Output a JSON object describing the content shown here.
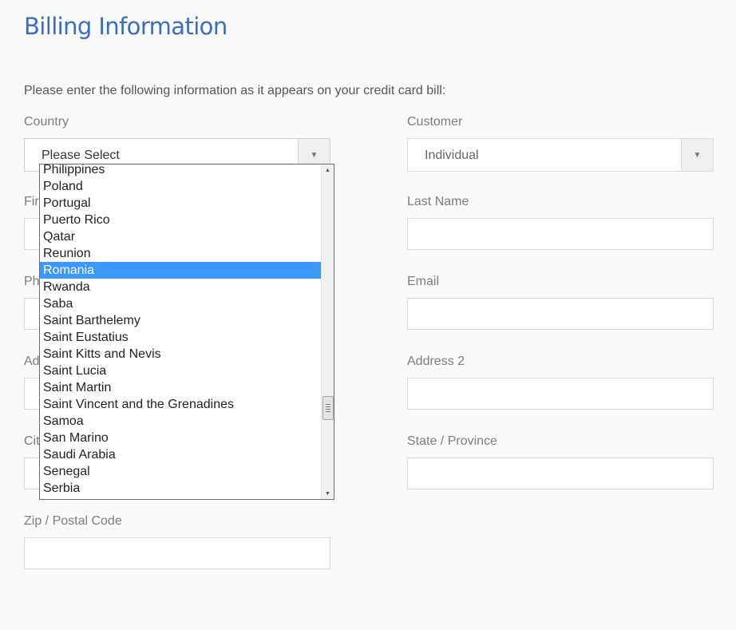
{
  "page": {
    "title": "Billing Information",
    "intro": "Please enter the following information as it appears on your credit card bill:"
  },
  "fields": {
    "country_label": "Country",
    "country_value": "Please Select",
    "customer_label": "Customer",
    "customer_value": "Individual",
    "first_name_label_visible": "Fir",
    "last_name_label": "Last Name",
    "phone_label_visible": "Ph",
    "email_label": "Email",
    "address_label_visible": "Ad",
    "address2_label": "Address 2",
    "city_label_visible": "Cit",
    "state_label": "State / Province",
    "zip_label": "Zip / Postal Code"
  },
  "dropdown": {
    "options": [
      "Philippines",
      "Poland",
      "Portugal",
      "Puerto Rico",
      "Qatar",
      "Reunion",
      "Romania",
      "Rwanda",
      "Saba",
      "Saint Barthelemy",
      "Saint Eustatius",
      "Saint Kitts and Nevis",
      "Saint Lucia",
      "Saint Martin",
      "Saint Vincent and the Grenadines",
      "Samoa",
      "San Marino",
      "Saudi Arabia",
      "Senegal",
      "Serbia"
    ],
    "selected": "Romania",
    "scroll_position": 0.76
  },
  "icons": {
    "select_arrow": "chevron-down-icon",
    "scroll_up": "scroll-up-arrow-icon",
    "scroll_down": "scroll-down-arrow-icon"
  },
  "colors": {
    "title": "#3a6cc5",
    "selected_bg": "#3c97ff",
    "background": "#fafafa"
  }
}
